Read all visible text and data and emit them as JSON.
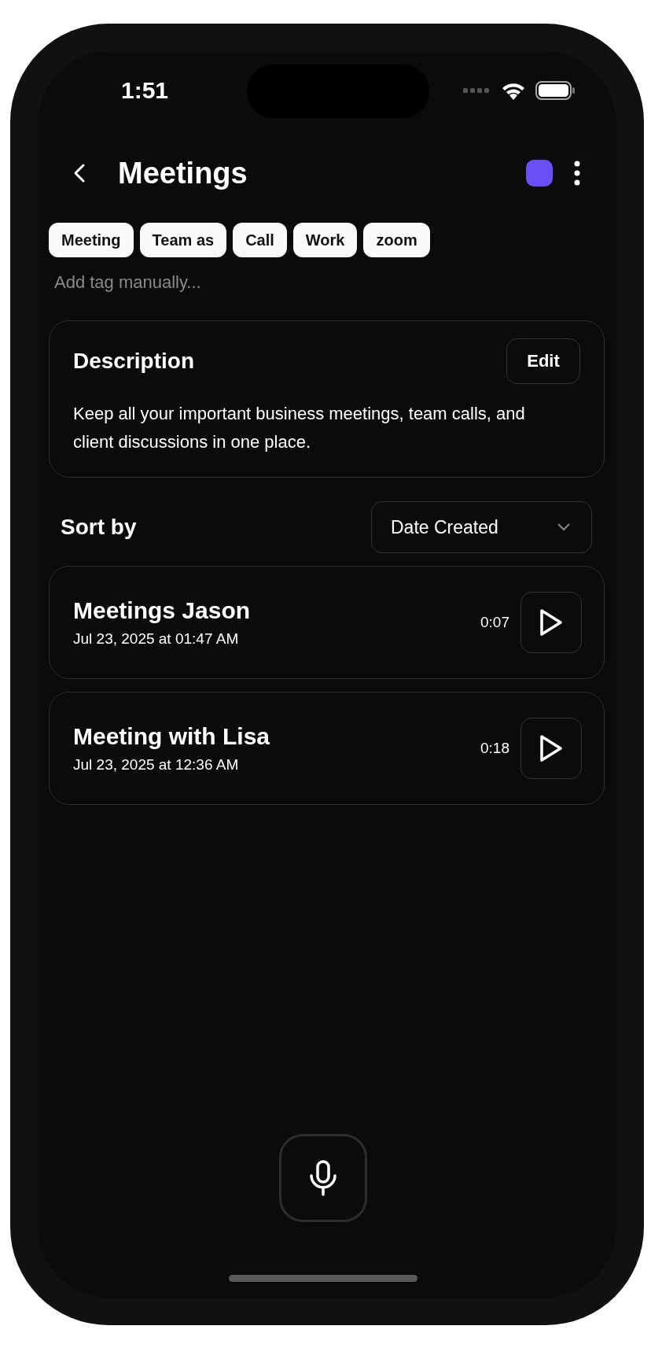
{
  "status_bar": {
    "time": "1:51"
  },
  "header": {
    "title": "Meetings",
    "color": "#6b4ff6"
  },
  "tags": [
    {
      "label": "Meeting"
    },
    {
      "label": "Team as"
    },
    {
      "label": "Call"
    },
    {
      "label": "Work"
    },
    {
      "label": "zoom"
    }
  ],
  "tag_input": {
    "placeholder": "Add tag manually..."
  },
  "description": {
    "title": "Description",
    "edit_button": "Edit",
    "text": "Keep all your important business meetings, team calls, and client discussions in one place."
  },
  "sort": {
    "label": "Sort by",
    "value": "Date Created"
  },
  "recordings": [
    {
      "title": "Meetings Jason",
      "date": "Jul 23, 2025 at 01:47 AM",
      "duration": "0:07"
    },
    {
      "title": "Meeting with Lisa",
      "date": "Jul 23, 2025 at 12:36 AM",
      "duration": "0:18"
    }
  ]
}
